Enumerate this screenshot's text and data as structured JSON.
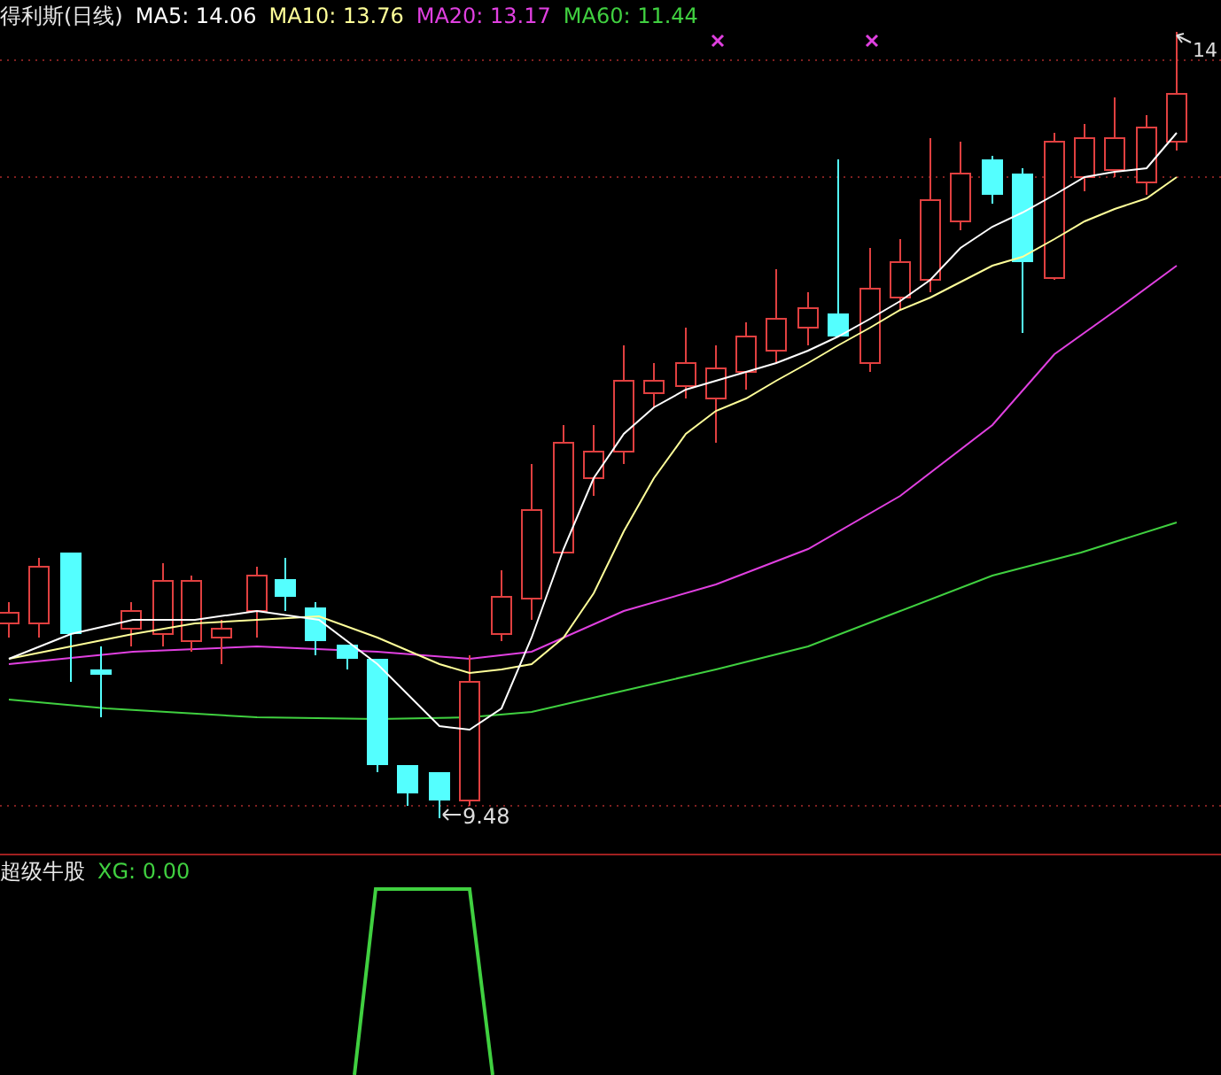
{
  "main_panel": {
    "title": "得利斯(日线)",
    "indicators": [
      {
        "label": "MA5: 14.06",
        "color": "#ffffff"
      },
      {
        "label": "MA10: 13.76",
        "color": "#ffff99"
      },
      {
        "label": "MA20: 13.17",
        "color": "#e040e0"
      },
      {
        "label": "MA60: 11.44",
        "color": "#40d040"
      }
    ],
    "high_label": "14",
    "low_label": "9.48"
  },
  "sub_panel": {
    "title": "超级牛股",
    "indicators": [
      {
        "label": "XG: 0.00",
        "color": "#40d040"
      }
    ]
  }
}
